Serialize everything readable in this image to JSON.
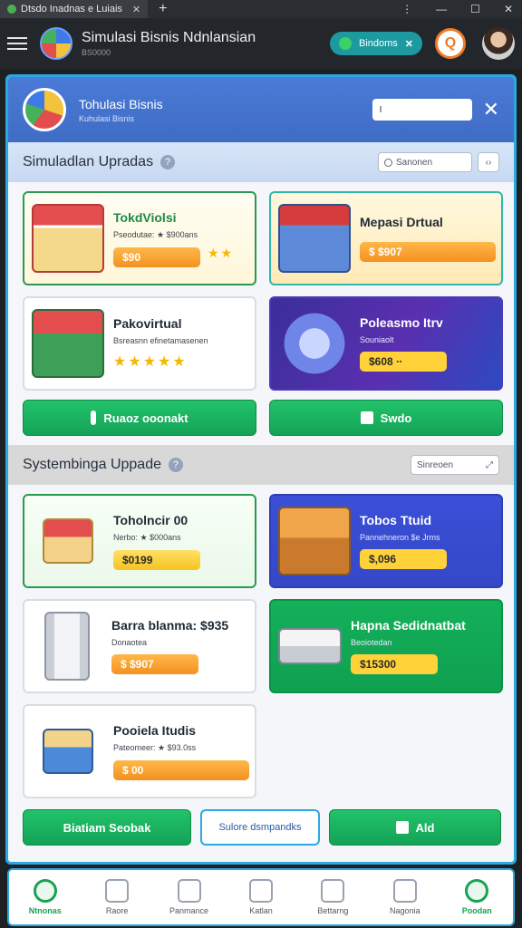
{
  "browser": {
    "tab_title": "Dtsdo Inadnas e Luiais",
    "new_tab": "+",
    "controls": [
      "⋮",
      "—",
      "☐",
      "✕"
    ]
  },
  "header": {
    "title": "Simulasi Bisnis Ndnlansian",
    "subtitle": "BS0000",
    "badge_label": "Bindoms",
    "badge_close": "✕",
    "notif_glyph": "Q"
  },
  "panel": {
    "title": "Tohulasi Bisnis",
    "subtitle": "Kuhulasi Bisnis",
    "input_value": "I",
    "close": "✕"
  },
  "section1": {
    "title": "Simuladlan Upradas",
    "info": "?",
    "search_placeholder": "Sanonen",
    "search_btn": "‹›",
    "cards": [
      {
        "title": "TokdViolsi",
        "sub": "Pseodutae: ★ $900ans",
        "price": "$90",
        "stars": "★★"
      },
      {
        "title": "Mepasi Drtual",
        "sub": "",
        "price": "$ $907"
      },
      {
        "title": "Pakovirtual",
        "sub": "Bsreasnn efinetamasenen",
        "stars": "★★★★★"
      },
      {
        "title": "Poleasmo Itrv",
        "sub": "Souniaolt",
        "price": "$608 ∙∙"
      }
    ],
    "btn_left": "Ruaoz ooonakt",
    "btn_right": "Swdo"
  },
  "section2": {
    "title": "Systembinga Uppade",
    "info": "?",
    "search_placeholder": "Sinreoen",
    "search_btn": "⤢",
    "cards": [
      {
        "title": "Toholncir 00",
        "sub": "Nerbo: ★ $000ans",
        "price": "$0199"
      },
      {
        "title": "Tobos Ttuid",
        "sub": "Pannehneron $e Jrms",
        "price": "$,096"
      },
      {
        "title": "Barra blanma: $935",
        "sub": "Donaotea",
        "price": "$ $907"
      },
      {
        "title": "Hapna Sedidnatbat",
        "sub": "Beoiotedan",
        "price": "$15300"
      },
      {
        "title": "Pooiela Itudis",
        "sub": "Pateomeer: ★ $93.0ss",
        "price": "$ 00"
      }
    ],
    "btn_left": "Biatiam Seobak",
    "btn_mid": "Sulore dsmpandks",
    "btn_right": "Ald"
  },
  "nav": [
    {
      "label": "Ntnonas",
      "active": true
    },
    {
      "label": "Raore",
      "active": false
    },
    {
      "label": "Panmance",
      "active": false
    },
    {
      "label": "Katlan",
      "active": false
    },
    {
      "label": "Bettarng",
      "active": false
    },
    {
      "label": "Nagonia",
      "active": false
    },
    {
      "label": "Poodan",
      "active": true
    }
  ],
  "colors": {
    "accent": "#2aa8e0",
    "green": "#18a352",
    "orange": "#f39120",
    "purple": "#4a3bb8",
    "blue": "#3448c8"
  }
}
